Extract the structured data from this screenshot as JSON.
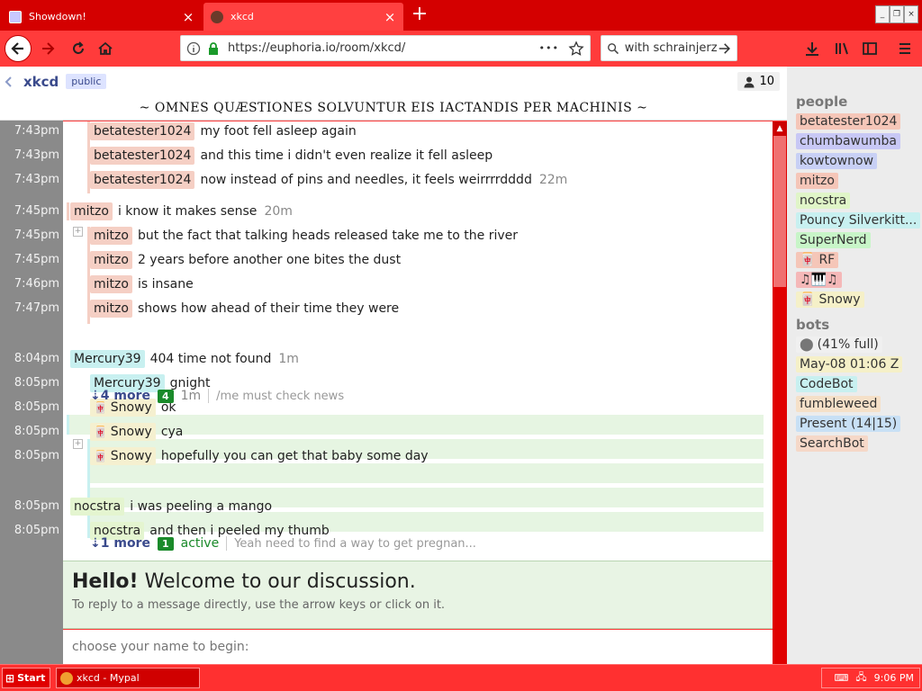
{
  "browser": {
    "tabs": [
      {
        "label": "Showdown!"
      },
      {
        "label": "xkcd"
      }
    ],
    "new_tab_symbol": "+",
    "url": "https://euphoria.io/room/xkcd/",
    "url_dots": "•••",
    "search_text": "with schrainjerz",
    "window_buttons": [
      "_",
      "❐",
      "×"
    ]
  },
  "room": {
    "name": "xkcd",
    "badge": "public",
    "user_count": "10",
    "topic": "~ OMNES QUÆSTIONES SOLVUNTUR EIS IACTANDIS PER MACHINIS ~"
  },
  "messages": [
    {
      "time": "7:43pm",
      "nick": "betatester1024",
      "text": "my foot fell asleep again",
      "ago": ""
    },
    {
      "time": "7:43pm",
      "nick": "betatester1024",
      "text": "and this time i didn't even realize it fell asleep",
      "ago": ""
    },
    {
      "time": "7:43pm",
      "nick": "betatester1024",
      "text": "now instead of pins and needles, it feels weirrrrdddd",
      "ago": "22m"
    },
    {
      "time": "7:45pm",
      "nick": "mitzo",
      "text": "i know it makes sense",
      "ago": "20m"
    },
    {
      "time": "7:45pm",
      "nick": "mitzo",
      "text": "but the fact that talking heads released take me to the river",
      "ago": ""
    },
    {
      "time": "7:45pm",
      "nick": "mitzo",
      "text": "2 years before another one bites the dust",
      "ago": ""
    },
    {
      "time": "7:46pm",
      "nick": "mitzo",
      "text": "is insane",
      "ago": ""
    },
    {
      "time": "7:47pm",
      "nick": "mitzo",
      "text": "shows how ahead of their time they were",
      "ago": ""
    },
    {
      "time": "8:04pm",
      "nick": "Mercury39",
      "text": "404 time not found",
      "ago": "1m"
    },
    {
      "time": "8:05pm",
      "nick": "Mercury39",
      "text": "gnight",
      "ago": ""
    },
    {
      "time": "8:05pm",
      "nick": "Snowy",
      "text": "ok",
      "ago": ""
    },
    {
      "time": "8:05pm",
      "nick": "Snowy",
      "text": "cya",
      "ago": ""
    },
    {
      "time": "8:05pm",
      "nick": "Snowy",
      "text": "hopefully you can get that baby some day",
      "ago": ""
    },
    {
      "time": "8:05pm",
      "nick": "nocstra",
      "text": "i was peeling a mango",
      "ago": ""
    },
    {
      "time": "8:05pm",
      "nick": "nocstra",
      "text": "and then i peeled my thumb",
      "ago": ""
    }
  ],
  "collapsed": [
    {
      "more": "4 more",
      "count": "4",
      "since": "1m",
      "preview": "/me must check news"
    },
    {
      "more": "1 more",
      "count": "1",
      "since": "active",
      "preview": "Yeah need to find a way to get pregnan..."
    }
  ],
  "welcome": {
    "hello": "Hello!",
    "title": "Welcome to our discussion.",
    "hint": "To reply to a message directly, use the arrow keys or click on it.",
    "name_placeholder": "choose your name to begin:"
  },
  "sidebar": {
    "people_heading": "people",
    "people": [
      {
        "name": "betatester1024",
        "color": "#f5c6b8"
      },
      {
        "name": "chumbawumba",
        "color": "#c8c8f5"
      },
      {
        "name": "kowtownow",
        "color": "#c8d0f5"
      },
      {
        "name": "mitzo",
        "color": "#f5c6b8"
      },
      {
        "name": "nocstra",
        "color": "#e0f5c8"
      },
      {
        "name": "Pouncy Silverkitt...",
        "color": "#c8f0f0"
      },
      {
        "name": "SuperNerd",
        "color": "#c8f5c8"
      },
      {
        "name": "RF",
        "color": "#f5c6b8",
        "prefix": "🀄"
      },
      {
        "name": "♫🎹♫",
        "color": "#f5b8b8"
      },
      {
        "name": "Snowy",
        "color": "#f5f0c8",
        "prefix": "🀄"
      }
    ],
    "bots_heading": "bots",
    "bots": [
      {
        "name": "(41% full)",
        "color": "#f0f0f0",
        "prefix": "⬤"
      },
      {
        "name": "May-08 01:06 Z",
        "color": "#f5f0c8"
      },
      {
        "name": "CodeBot",
        "color": "#c8f0f0"
      },
      {
        "name": "fumbleweed",
        "color": "#f5e0c8"
      },
      {
        "name": "Present (14|15)",
        "color": "#c8e0f5"
      },
      {
        "name": "SearchBot",
        "color": "#f5d8c8"
      }
    ]
  },
  "taskbar": {
    "start": "Start",
    "task": "xkcd - Mypal",
    "clock": "9:06 PM"
  },
  "nick_colors": {
    "betatester1024": "#f5cfc4",
    "mitzo": "#f5cfc4",
    "Mercury39": "#c8f0f0",
    "Snowy": "#f5f0d0",
    "nocstra": "#e4f5d0"
  }
}
